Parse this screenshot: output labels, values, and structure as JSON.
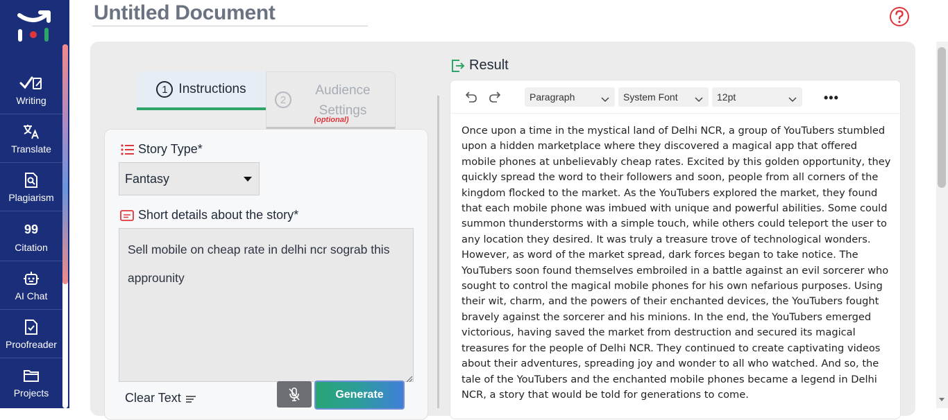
{
  "document": {
    "title": "Untitled Document"
  },
  "sidebar": {
    "items": [
      {
        "label": "Writing",
        "icon": "writing-icon"
      },
      {
        "label": "Translate",
        "icon": "translate-icon"
      },
      {
        "label": "Plagiarism",
        "icon": "plagiarism-icon"
      },
      {
        "label": "Citation",
        "icon": "quote-icon"
      },
      {
        "label": "AI Chat",
        "icon": "robot-icon"
      },
      {
        "label": "Proofreader",
        "icon": "proofreader-icon"
      },
      {
        "label": "Projects",
        "icon": "folder-icon"
      }
    ]
  },
  "tabs": {
    "instructions": {
      "number": "1",
      "label": "Instructions"
    },
    "audience": {
      "number": "2",
      "label": "Audience Settings",
      "note": "(optional)"
    }
  },
  "form": {
    "story_type_label": "Story Type*",
    "story_type_value": "Fantasy",
    "details_label": "Short details about the story*",
    "details_value": "Sell mobile on cheap rate in delhi ncr sograb this approunity",
    "clear_label": "Clear Text",
    "generate_label": "Generate"
  },
  "result": {
    "heading": "Result",
    "paragraph_style": "Paragraph",
    "font_family": "System Font",
    "font_size": "12pt",
    "more": "•••",
    "text": "Once upon a time in the mystical land of Delhi NCR, a group of YouTubers stumbled upon a hidden marketplace where they discovered a magical app that offered mobile phones at unbelievably cheap rates. Excited by this golden opportunity, they quickly spread the word to their followers and soon, people from all corners of the kingdom flocked to the market. As the YouTubers explored the market, they found that each mobile phone was imbued with unique and powerful abilities. Some could summon thunderstorms with a simple touch, while others could teleport the user to any location they desired. It was truly a treasure trove of technological wonders. However, as word of the market spread, dark forces began to take notice. The YouTubers soon found themselves embroiled in a battle against an evil sorcerer who sought to control the magical mobile phones for his own nefarious purposes. Using their wit, charm, and the powers of their enchanted devices, the YouTubers fought bravely against the sorcerer and his minions. In the end, the YouTubers emerged victorious, having saved the market from destruction and secured its magical treasures for the people of Delhi NCR. They continued to create captivating videos about their adventures, spreading joy and wonder to all who watched. And so, the tale of the YouTubers and the enchanted mobile phones became a legend in Delhi NCR, a story that would be told for generations to come."
  },
  "colors": {
    "sidebar": "#1a2e7a",
    "accent_green": "#2ea46b",
    "accent_red": "#e0363c"
  }
}
